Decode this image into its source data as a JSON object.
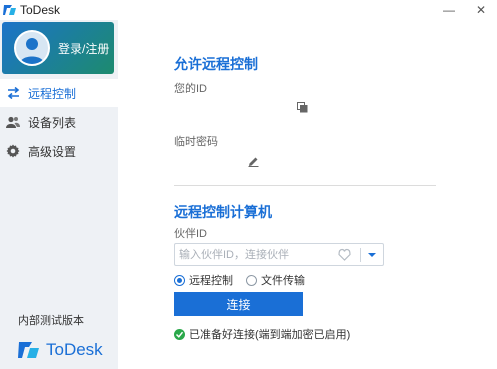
{
  "app": {
    "title": "ToDesk"
  },
  "window_controls": {
    "minimize": "—",
    "close": "✕"
  },
  "sidebar": {
    "login_label": "登录/注册",
    "items": [
      {
        "label": "远程控制",
        "icon": "swap-arrows-icon",
        "active": true
      },
      {
        "label": "设备列表",
        "icon": "users-icon",
        "active": false
      },
      {
        "label": "高级设置",
        "icon": "gear-icon",
        "active": false
      }
    ],
    "version_label": "内部测试版本",
    "brand": "ToDesk"
  },
  "allow": {
    "title": "允许远程控制",
    "id_label": "您的ID",
    "password_label": "临时密码"
  },
  "control": {
    "title": "远程控制计算机",
    "partner_label": "伙伴ID",
    "partner_placeholder": "输入伙伴ID，连接伙伴",
    "partner_value": "",
    "modes": [
      {
        "label": "远程控制",
        "selected": true
      },
      {
        "label": "文件传输",
        "selected": false
      }
    ],
    "connect_label": "连接",
    "status_text": "已准备好连接(端到端加密已启用)"
  },
  "colors": {
    "accent": "#1a6fd6",
    "sidebar_bg": "#eef1f5",
    "status_ok": "#2aa84a"
  }
}
